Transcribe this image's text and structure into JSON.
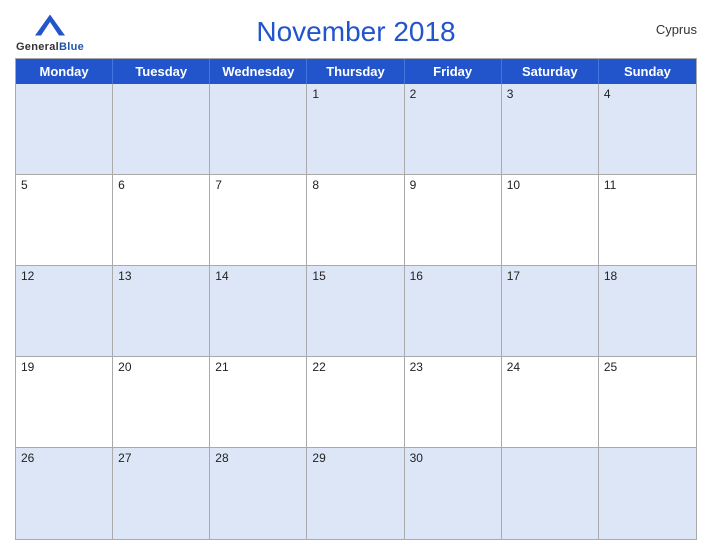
{
  "header": {
    "title": "November 2018",
    "country": "Cyprus",
    "logo": {
      "general": "General",
      "blue": "Blue"
    }
  },
  "days_of_week": [
    "Monday",
    "Tuesday",
    "Wednesday",
    "Thursday",
    "Friday",
    "Saturday",
    "Sunday"
  ],
  "weeks": [
    [
      {
        "day": "",
        "empty": true
      },
      {
        "day": "",
        "empty": true
      },
      {
        "day": "",
        "empty": true
      },
      {
        "day": "1",
        "empty": false
      },
      {
        "day": "2",
        "empty": false
      },
      {
        "day": "3",
        "empty": false
      },
      {
        "day": "4",
        "empty": false
      }
    ],
    [
      {
        "day": "5",
        "empty": false
      },
      {
        "day": "6",
        "empty": false
      },
      {
        "day": "7",
        "empty": false
      },
      {
        "day": "8",
        "empty": false
      },
      {
        "day": "9",
        "empty": false
      },
      {
        "day": "10",
        "empty": false
      },
      {
        "day": "11",
        "empty": false
      }
    ],
    [
      {
        "day": "12",
        "empty": false
      },
      {
        "day": "13",
        "empty": false
      },
      {
        "day": "14",
        "empty": false
      },
      {
        "day": "15",
        "empty": false
      },
      {
        "day": "16",
        "empty": false
      },
      {
        "day": "17",
        "empty": false
      },
      {
        "day": "18",
        "empty": false
      }
    ],
    [
      {
        "day": "19",
        "empty": false
      },
      {
        "day": "20",
        "empty": false
      },
      {
        "day": "21",
        "empty": false
      },
      {
        "day": "22",
        "empty": false
      },
      {
        "day": "23",
        "empty": false
      },
      {
        "day": "24",
        "empty": false
      },
      {
        "day": "25",
        "empty": false
      }
    ],
    [
      {
        "day": "26",
        "empty": false
      },
      {
        "day": "27",
        "empty": false
      },
      {
        "day": "28",
        "empty": false
      },
      {
        "day": "29",
        "empty": false
      },
      {
        "day": "30",
        "empty": false
      },
      {
        "day": "",
        "empty": true
      },
      {
        "day": "",
        "empty": true
      }
    ]
  ]
}
